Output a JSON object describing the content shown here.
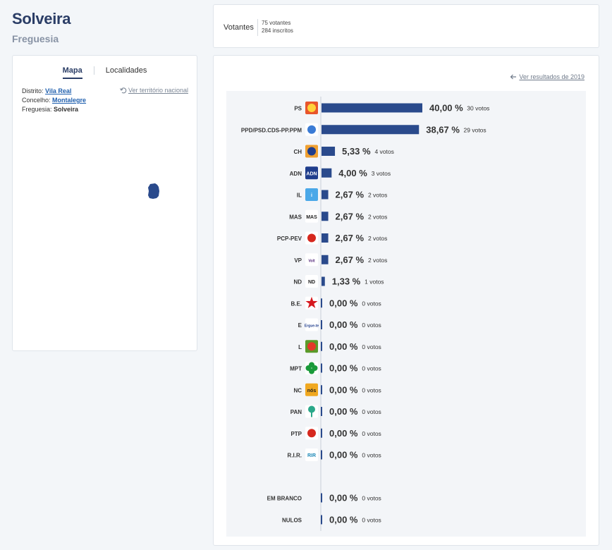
{
  "header": {
    "title": "Solveira",
    "subtitle": "Freguesia"
  },
  "map_panel": {
    "tabs": [
      {
        "label": "Mapa",
        "active": true
      },
      {
        "label": "Localidades",
        "active": false
      }
    ],
    "territory": {
      "distrito_label": "Distrito:",
      "distrito": "Vila Real",
      "concelho_label": "Concelho:",
      "concelho": "Montalegre",
      "freguesia_label": "Freguesia:",
      "freguesia": "Solveira"
    },
    "national_link": "Ver território nacional",
    "map_color": "#2a4a8c"
  },
  "voters": {
    "label": "Votantes",
    "voters_line": "75 votantes",
    "registered_line": "284 inscritos"
  },
  "results": {
    "previous_link": "Ver resultados de 2019"
  },
  "chart_data": {
    "type": "bar",
    "orientation": "horizontal",
    "bar_color": "#2a4a8c",
    "xlim": [
      0,
      100
    ],
    "categories": [
      "PS",
      "PPD/PSD.CDS-PP.PPM",
      "CH",
      "ADN",
      "IL",
      "MAS",
      "PCP-PEV",
      "VP",
      "ND",
      "B.E.",
      "E",
      "L",
      "MPT",
      "NC",
      "PAN",
      "PTP",
      "R.I.R.",
      "EM BRANCO",
      "NULOS"
    ],
    "percent_labels": [
      "40,00 %",
      "38,67 %",
      "5,33 %",
      "4,00 %",
      "2,67 %",
      "2,67 %",
      "2,67 %",
      "2,67 %",
      "1,33 %",
      "0,00 %",
      "0,00 %",
      "0,00 %",
      "0,00 %",
      "0,00 %",
      "0,00 %",
      "0,00 %",
      "0,00 %",
      "0,00 %",
      "0,00 %"
    ],
    "vote_labels": [
      "30 votos",
      "29 votos",
      "4 votos",
      "3 votos",
      "2 votos",
      "2 votos",
      "2 votos",
      "2 votos",
      "1 votos",
      "0 votos",
      "0 votos",
      "0 votos",
      "0 votos",
      "0 votos",
      "0 votos",
      "0 votos",
      "0 votos",
      "0 votos",
      "0 votos"
    ],
    "values": [
      40.0,
      38.67,
      5.33,
      4.0,
      2.67,
      2.67,
      2.67,
      2.67,
      1.33,
      0,
      0,
      0,
      0,
      0,
      0,
      0,
      0,
      0,
      0
    ],
    "votes": [
      30,
      29,
      4,
      3,
      2,
      2,
      2,
      2,
      1,
      0,
      0,
      0,
      0,
      0,
      0,
      0,
      0,
      0,
      0
    ],
    "logos": [
      {
        "icon": "ps-fist-rose-icon",
        "bg": "#e8552c",
        "color": "#ffd23a"
      },
      {
        "icon": "ppd-coalition-icon",
        "bg": "#ffffff",
        "color": "#3a7bd5"
      },
      {
        "icon": "chega-icon",
        "bg": "#f0a030",
        "color": "#1f3d8c"
      },
      {
        "icon": "adn-icon",
        "bg": "#1f3d8c",
        "color": "#ffffff",
        "text": "ADN"
      },
      {
        "icon": "il-icon",
        "bg": "#4aa8e8",
        "color": "#ffffff",
        "text": "i"
      },
      {
        "icon": "mas-icon",
        "bg": "#ffffff",
        "color": "#222222",
        "text": "MAS"
      },
      {
        "icon": "pcp-pev-icon",
        "bg": "#ffffff",
        "color": "#d6281e"
      },
      {
        "icon": "volt-icon",
        "bg": "#ffffff",
        "color": "#502379",
        "text": "Volt"
      },
      {
        "icon": "nos-cidadaos-nd-icon",
        "bg": "#ffffff",
        "color": "#222222",
        "text": "ND"
      },
      {
        "icon": "be-star-icon",
        "bg": "#ffffff",
        "color": "#d6181e"
      },
      {
        "icon": "ergue-te-icon",
        "bg": "#ffffff",
        "color": "#1f3d8c",
        "text": "Ergue-te"
      },
      {
        "icon": "livre-icon",
        "bg": "#5a9a2a",
        "color": "#e2382a"
      },
      {
        "icon": "mpt-clover-icon",
        "bg": "#ffffff",
        "color": "#1a9a3a"
      },
      {
        "icon": "nc-icon",
        "bg": "#f0a820",
        "color": "#222222",
        "text": "nós"
      },
      {
        "icon": "pan-tree-icon",
        "bg": "#ffffff",
        "color": "#2aa88a"
      },
      {
        "icon": "ptp-icon",
        "bg": "#ffffff",
        "color": "#d6281e"
      },
      {
        "icon": "rir-icon",
        "bg": "#ffffff",
        "color": "#1f8ab8",
        "text": "RIR"
      },
      {
        "icon": "",
        "bg": "",
        "color": ""
      },
      {
        "icon": "",
        "bg": "",
        "color": ""
      }
    ]
  }
}
